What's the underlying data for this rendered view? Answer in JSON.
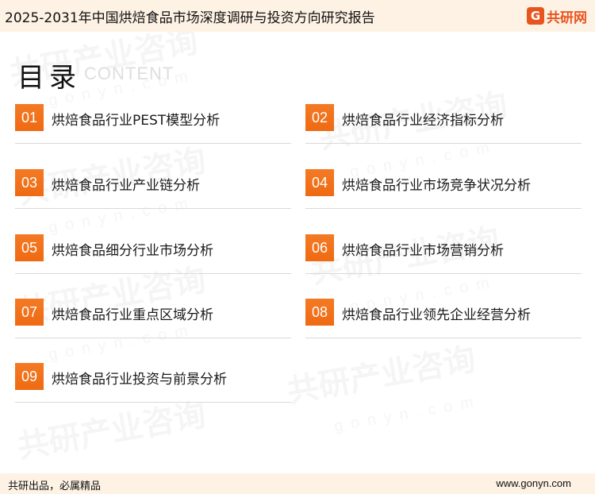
{
  "header": {
    "title": "2025-2031年中国烘焙食品市场深度调研与投资方向研究报告",
    "brand_mark": "G",
    "brand_name": "共研网"
  },
  "section": {
    "heading": "目录",
    "subheading": "CONTENT"
  },
  "toc": [
    {
      "num": "01",
      "label": "烘焙食品行业PEST模型分析"
    },
    {
      "num": "02",
      "label": "烘焙食品行业经济指标分析"
    },
    {
      "num": "03",
      "label": "烘焙食品行业产业链分析"
    },
    {
      "num": "04",
      "label": "烘焙食品行业市场竞争状况分析"
    },
    {
      "num": "05",
      "label": "烘焙食品细分行业市场分析"
    },
    {
      "num": "06",
      "label": "烘焙食品行业市场营销分析"
    },
    {
      "num": "07",
      "label": "烘焙食品行业重点区域分析"
    },
    {
      "num": "08",
      "label": "烘焙食品行业领先企业经营分析"
    },
    {
      "num": "09",
      "label": "烘焙食品行业投资与前景分析"
    }
  ],
  "watermark": {
    "text": "共研产业咨询",
    "url": "gonyn.com"
  },
  "footer": {
    "slogan": "共研出品，必属精品",
    "url": "www.gonyn.com"
  },
  "colors": {
    "accent": "#ef6a12",
    "bar_bg": "#fdf2e4",
    "brand": "#e8541e"
  }
}
